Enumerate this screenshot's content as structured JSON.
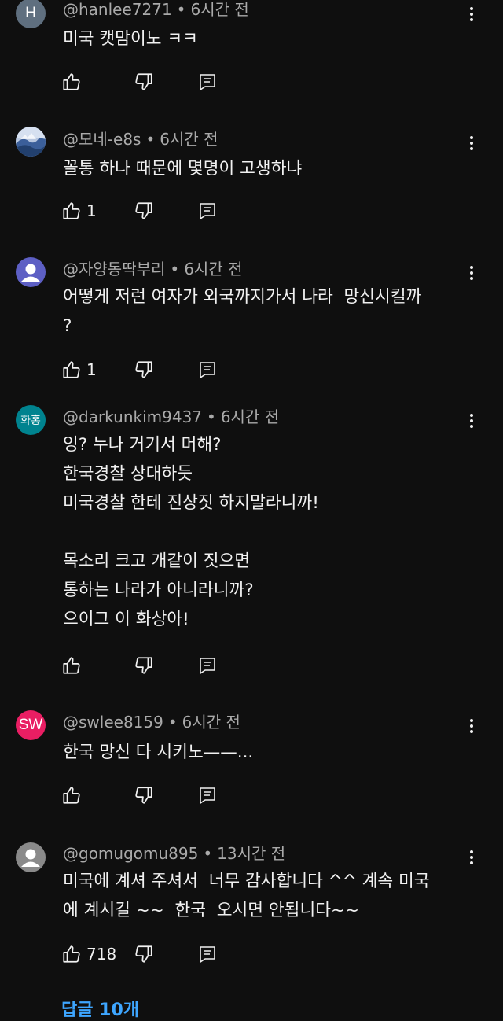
{
  "colors": {
    "background": "#0f0f0f",
    "text": "#f1f1f1",
    "meta_text": "#aaaaaa",
    "link": "#3ea6ff"
  },
  "comments": [
    {
      "username": "@hanlee7271",
      "time": "6시간 전",
      "text": "미국 캣맘이노 ㅋㅋ",
      "likes": "",
      "avatar": {
        "type": "letter",
        "letter": "H",
        "bg": "#5f6f7f"
      }
    },
    {
      "username": "@모네-e8s",
      "time": "6시간 전",
      "text": "꼴통 하나 때문에 몇명이 고생하냐",
      "likes": "1",
      "avatar": {
        "type": "image",
        "icon": "landscape-photo-icon"
      }
    },
    {
      "username": "@자양동딱부리",
      "time": "6시간 전",
      "text": "어떻게 저런 여자가 외국까지가서 나라  망신시킬까\n?",
      "likes": "1",
      "avatar": {
        "type": "default",
        "icon": "default-person-icon",
        "bg": "#5d5fc4"
      }
    },
    {
      "username": "@darkunkim9437",
      "time": "6시간 전",
      "text": "잉? 누나 거기서 머해?\n한국경찰 상대하듯\n미국경찰 한테 진상짓 하지말라니까!\n\n목소리 크고 개같이 짓으면\n통하는 나라가 아니라니까?\n으이그 이 화상아!",
      "likes": "",
      "avatar": {
        "type": "letter",
        "letter": "화홍",
        "bg": "#00838f"
      }
    },
    {
      "username": "@swlee8159",
      "time": "6시간 전",
      "text": "한국 망신 다 시키노——...",
      "likes": "",
      "avatar": {
        "type": "letter",
        "letter": "SW",
        "bg": "#e91e63"
      }
    },
    {
      "username": "@gomugomu895",
      "time": "13시간 전",
      "text": "미국에 계셔 주셔서  너무 감사합니다 ^^ 계속 미국\n에 계시길 ~~  한국  오시면 안됩니다~~",
      "likes": "718",
      "avatar": {
        "type": "default",
        "icon": "default-person-icon",
        "bg": "#8a8a8a"
      }
    }
  ],
  "icons": {
    "like": "thumbs-up-icon",
    "dislike": "thumbs-down-icon",
    "reply": "reply-icon",
    "more": "more-vert-icon"
  },
  "replies_link": "답글 10개"
}
